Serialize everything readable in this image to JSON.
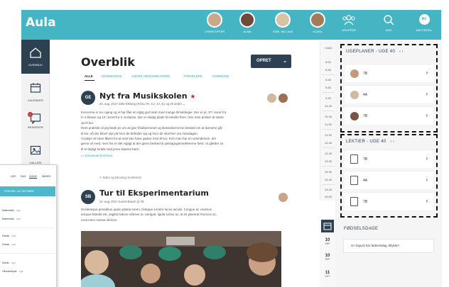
{
  "app": {
    "logo": "Aula"
  },
  "topbar": {
    "children": [
      {
        "name": "CHRISTOFFER"
      },
      {
        "name": "ALMA"
      },
      {
        "name": "KARL WILLIAM"
      },
      {
        "name": "KLARA"
      }
    ],
    "items": [
      {
        "label": "GRUPPER",
        "icon": "groups-icon"
      },
      {
        "label": "SØG",
        "icon": "search-icon"
      },
      {
        "label": "MIN PROFIL",
        "avatar_initials": "MJ",
        "icon": "avatar"
      }
    ]
  },
  "sidebar": {
    "items": [
      {
        "label": "OVERBLIK",
        "icon": "home-icon"
      },
      {
        "label": "KALENDER",
        "icon": "calendar-icon"
      },
      {
        "label": "BESKEDER",
        "icon": "messages-icon",
        "badge": "1"
      },
      {
        "label": "GALLERI",
        "icon": "gallery-icon"
      }
    ]
  },
  "main": {
    "title": "Overblik",
    "create_button": "OPRET",
    "tabs": [
      "ALLE",
      "MARKEREDE",
      "ANDRE MEDARBEJDERE",
      "FORÆLDRE",
      "KOMMUNE"
    ],
    "posts": [
      {
        "initials": "GE",
        "title": "Nyt fra Musikskolen",
        "meta": "25. aug. 2017  Gitte Elsborg (KOLL 0V, 1U, 1V, 2U og  20 andre ⌄",
        "body": [
          "Koncerne er nu i gang og vi har fået en rigtig god start med mange tilmeldinger. Der er pt. 37 i koret fra",
          "0.-2.klasse og 12 i koret fra 3.-6.klasse. Der er stadig plads til enkelte flere, hvis man ønsker at starte",
          "op til kor.",
          "Rent praktisk vil jeg bede jer om at give fritidsjerneset og klassebørnerne besked om at børnene går",
          "til kor, så der bliver styr på hvor de befinder sig og hvor de skal hen om mandagen.",
          "Vi plejer at have åbent for at man kan have gaster med til kor, hvis man har en veninde/ven, der",
          "gerne vil med, men hvr er det vigtigt at der gives besked til pædagogerne/lærerne først. Vi glæder os",
          "til et dejligt forløb med jeres skønne børn."
        ],
        "attachment": "Download brochure"
      },
      {
        "initials": "SB",
        "category": "Natur og teknologi mellemtrin",
        "title": "Tur til Eksperimentarium",
        "meta": "24. aug. 2017  Svend Busch (4 7B",
        "body": [
          "Scelerisque penatibus quam platea lorem, tristique a tortor lacus iaculis. Congue ac vivamus",
          "tempus blandit est, sagittis labore ultrices ac volutpat, ligula luctus ac, at sit placerat rhoncus ac,",
          "urna enim massa ultrices."
        ]
      }
    ]
  },
  "timeline": {
    "header": "I DAG",
    "times": [
      "8.00",
      "8.45",
      "8.45",
      "9.30",
      "9.30",
      "10.15",
      "10.45",
      "11.30",
      "11.30",
      "12.45",
      "12.45",
      "13.30",
      "13.30",
      "14.45",
      "14.15",
      "15.00"
    ]
  },
  "calendar_strip": {
    "days": [
      {
        "day": "10",
        "month": "SEP"
      },
      {
        "day": "10",
        "month": "SEP"
      },
      {
        "day": "11",
        "month": "OKT"
      }
    ]
  },
  "weekplans": {
    "title": "UGEPLANER - UGE 40",
    "nav": "‹ ›",
    "rows": [
      {
        "label": "7B"
      },
      {
        "label": "4A"
      },
      {
        "label": "7B"
      }
    ]
  },
  "homework": {
    "title": "LEKTIER - UGE 40",
    "nav": "‹ ›",
    "rows": [
      {
        "label": "7B"
      },
      {
        "label": "4A"
      },
      {
        "label": "7B"
      }
    ]
  },
  "birthdays": {
    "title": "FØDSELSDAGE",
    "text": "4A Sigurd har fødselsdag, tillykke!"
  },
  "phone": {
    "tabs": [
      "UGE",
      "DAG",
      "IDAGE",
      "MÅNED"
    ],
    "banner": "PERIODE: UG 'OKTOBER'",
    "items": [
      {
        "name": "Matematik",
        "sub": " - uge"
      },
      {
        "name": "Matematik",
        "sub": " - uge"
      },
      {
        "name": "Dansk",
        "sub": " - uge"
      },
      {
        "name": "Dansk",
        "sub": " - uge"
      },
      {
        "name": "Musik",
        "sub": " - uge"
      },
      {
        "name": "Håndarbejde",
        "sub": " - uge"
      }
    ]
  },
  "colors": {
    "brand": "#45b5c4",
    "navy": "#2e4152",
    "star": "#d9273f",
    "link": "#45a6b6"
  }
}
